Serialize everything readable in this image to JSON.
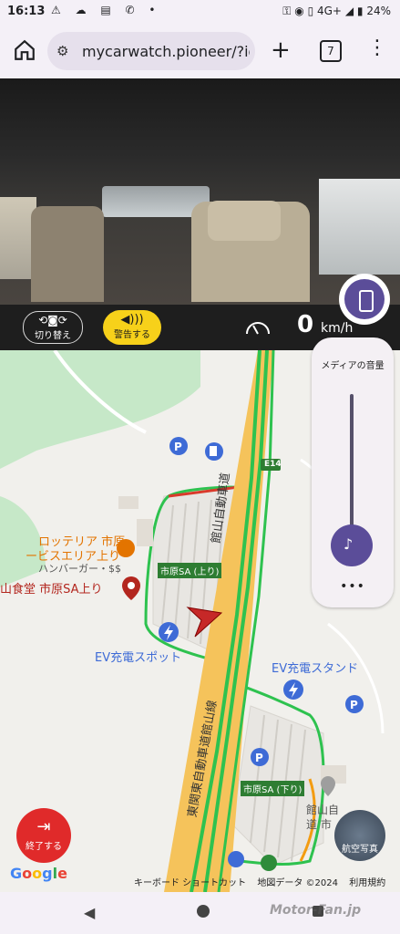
{
  "status_bar": {
    "time": "16:13",
    "left_icons": [
      "warning-icon",
      "cloud-icon",
      "sim-icon",
      "wifi-call-icon",
      "dot-icon"
    ],
    "right_icons": [
      "key-icon",
      "location-icon",
      "vibrate-icon"
    ],
    "network": "4G+",
    "battery": "24%"
  },
  "browser": {
    "url": "mycarwatch.pioneer/?id=",
    "tab_count": "7"
  },
  "camera_controls": {
    "switch_label": "切り替え",
    "warn_label": "警告する",
    "speed_value": "0",
    "speed_unit": "km/h"
  },
  "volume_panel": {
    "title": "メディアの音量",
    "more": "•••"
  },
  "map": {
    "pois": {
      "lotteria": "ロッテリア 市原",
      "lotteria_sub": "ービスエリア上り",
      "lotteria_cat": "ハンバーガー・$$",
      "shokudo": "山食堂 市原SA上り",
      "sa_up": "市原SA (上り)",
      "ev_spot": "EV充電スポット",
      "ev_stand": "EV充電スタンド",
      "sa_down": "市原SA (下り)",
      "route_badge": "E14",
      "tateyama_road": "館山自動車道",
      "higashi_kanto": "東関東自動車道館山線",
      "tateyama_cut": "館山自",
      "tateyama_cut2": "道 市"
    },
    "colors": {
      "highway_fill": "#f5c35b",
      "highway_traffic": "#2ec24f",
      "congestion": "#d93a2b",
      "park_green": "#c6e8c8",
      "poi_orange": "#e37400",
      "poi_blue": "#3e6bd6"
    }
  },
  "end_button": {
    "label": "終了する"
  },
  "aerial_button": {
    "label": "航空写真"
  },
  "attribution": {
    "google": "Google",
    "keyboard": "キーボード ショートカット",
    "map_data": "地図データ ©2024",
    "terms": "利用規約"
  },
  "watermark": "Motor-Fan.jp"
}
